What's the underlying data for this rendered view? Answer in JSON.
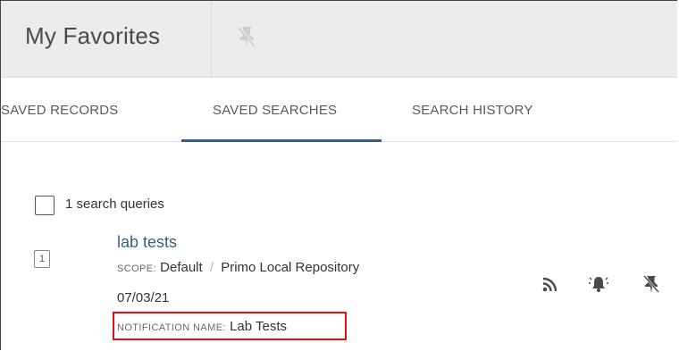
{
  "header": {
    "title": "My Favorites"
  },
  "tabs": [
    {
      "label": "SAVED RECORDS"
    },
    {
      "label": "SAVED SEARCHES"
    },
    {
      "label": "SEARCH HISTORY"
    }
  ],
  "active_tab": "SAVED SEARCHES",
  "list": {
    "count_label": "1 search queries",
    "items": [
      {
        "index": "1",
        "title": "lab tests",
        "scope_label": "SCOPE:",
        "scope_value": "Default",
        "scope_separator": "/",
        "scope_repository": "Primo Local Repository",
        "date": "07/03/21",
        "notification_label": "NOTIFICATION NAME:",
        "notification_value": "Lab Tests"
      }
    ]
  },
  "icons": {
    "header": "unpin-icon",
    "actions": [
      "rss-icon",
      "bell-icon",
      "unpin-icon"
    ]
  },
  "colors": {
    "accent": "#3b5f80",
    "highlight_box": "#e01010",
    "header_bg": "#ececec"
  }
}
